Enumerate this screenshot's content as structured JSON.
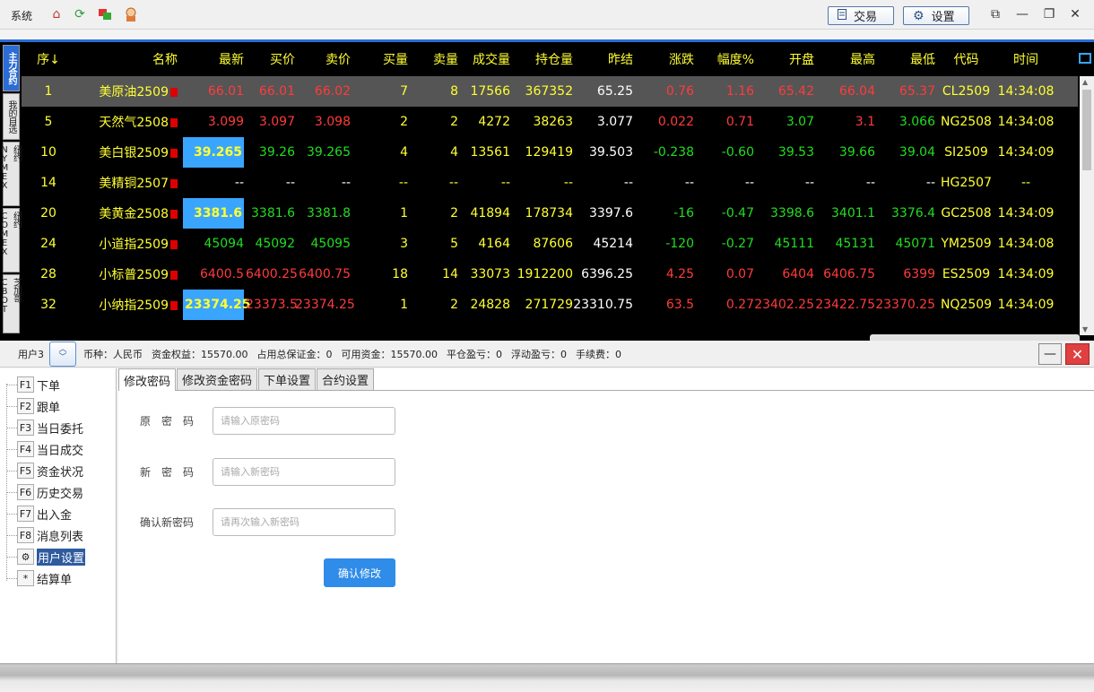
{
  "topbar": {
    "system_menu": "系统",
    "trade_button": "交易",
    "settings_button": "设置"
  },
  "vtabs": [
    "主力合约",
    "我的自选",
    "纽约NYMEX",
    "纽约COMEX",
    "芝加哥CBOT"
  ],
  "quote_headers": {
    "seq": "序↓",
    "name": "名称",
    "last": "最新",
    "bid": "买价",
    "ask": "卖价",
    "bid_qty": "买量",
    "ask_qty": "卖量",
    "volume": "成交量",
    "oi": "持仓量",
    "pre": "昨结",
    "chg": "涨跌",
    "pct": "幅度%",
    "open": "开盘",
    "high": "最高",
    "low": "最低",
    "code": "代码",
    "time": "时间"
  },
  "quotes": [
    {
      "seq": "1",
      "name": "美原油2509",
      "last": "66.01",
      "bid": "66.01",
      "ask": "66.02",
      "bid_qty": "7",
      "ask_qty": "8",
      "volume": "17566",
      "oi": "367352",
      "pre": "65.25",
      "chg": "0.76",
      "pct": "1.16",
      "open": "65.42",
      "high": "66.04",
      "low": "65.37",
      "code": "CL2509",
      "time": "14:34:08",
      "dir": "up",
      "selected": true,
      "hl": false
    },
    {
      "seq": "5",
      "name": "天然气2508",
      "last": "3.099",
      "bid": "3.097",
      "ask": "3.098",
      "bid_qty": "2",
      "ask_qty": "2",
      "volume": "4272",
      "oi": "38263",
      "pre": "3.077",
      "chg": "0.022",
      "pct": "0.71",
      "open": "3.07",
      "high": "3.1",
      "low": "3.066",
      "code": "NG2508",
      "time": "14:34:08",
      "dir": "up",
      "open_dir": "down",
      "high_dir": "up",
      "low_dir": "down"
    },
    {
      "seq": "10",
      "name": "美白银2509",
      "last": "39.265",
      "bid": "39.26",
      "ask": "39.265",
      "bid_qty": "4",
      "ask_qty": "4",
      "volume": "13561",
      "oi": "129419",
      "pre": "39.503",
      "chg": "-0.238",
      "pct": "-0.60",
      "open": "39.53",
      "high": "39.66",
      "low": "39.04",
      "code": "SI2509",
      "time": "14:34:09",
      "dir": "down",
      "hl": true
    },
    {
      "seq": "14",
      "name": "美精铜2507",
      "last": "--",
      "bid": "--",
      "ask": "--",
      "bid_qty": "--",
      "ask_qty": "--",
      "volume": "--",
      "oi": "--",
      "pre": "--",
      "chg": "--",
      "pct": "--",
      "open": "--",
      "high": "--",
      "low": "--",
      "code": "HG2507",
      "time": "--",
      "dir": "none"
    },
    {
      "seq": "20",
      "name": "美黄金2508",
      "last": "3381.6",
      "bid": "3381.6",
      "ask": "3381.8",
      "bid_qty": "1",
      "ask_qty": "2",
      "volume": "41894",
      "oi": "178734",
      "pre": "3397.6",
      "chg": "-16",
      "pct": "-0.47",
      "open": "3398.6",
      "high": "3401.1",
      "low": "3376.4",
      "code": "GC2508",
      "time": "14:34:09",
      "dir": "down",
      "hl": true
    },
    {
      "seq": "24",
      "name": "小道指2509",
      "last": "45094",
      "bid": "45092",
      "ask": "45095",
      "bid_qty": "3",
      "ask_qty": "5",
      "volume": "4164",
      "oi": "87606",
      "pre": "45214",
      "chg": "-120",
      "pct": "-0.27",
      "open": "45111",
      "high": "45131",
      "low": "45071",
      "code": "YM2509",
      "time": "14:34:08",
      "dir": "down"
    },
    {
      "seq": "28",
      "name": "小标普2509",
      "last": "6400.5",
      "bid": "6400.25",
      "ask": "6400.75",
      "bid_qty": "18",
      "ask_qty": "14",
      "volume": "33073",
      "oi": "1912200",
      "pre": "6396.25",
      "chg": "4.25",
      "pct": "0.07",
      "open": "6404",
      "high": "6406.75",
      "low": "6399",
      "code": "ES2509",
      "time": "14:34:09",
      "dir": "up"
    },
    {
      "seq": "32",
      "name": "小纳指2509",
      "last": "23374.25",
      "bid": "23373.5",
      "ask": "23374.25",
      "bid_qty": "1",
      "ask_qty": "2",
      "volume": "24828",
      "oi": "271729",
      "pre": "23310.75",
      "chg": "63.5",
      "pct": "0.27",
      "open": "23402.25",
      "high": "23422.75",
      "low": "23370.25",
      "code": "NQ2509",
      "time": "14:34:09",
      "dir": "up",
      "hl": true
    }
  ],
  "account": {
    "user": "用户3",
    "currency": "币种：人民币",
    "equity": "资金权益：15570.00",
    "margin": "占用总保证金：0",
    "available": "可用资金：15570.00",
    "close_pl": "平仓盈亏：0",
    "float_pl": "浮动盈亏：0",
    "fee": "手续费：0"
  },
  "tree": [
    {
      "key": "F1",
      "label": "下单"
    },
    {
      "key": "F2",
      "label": "跟单"
    },
    {
      "key": "F3",
      "label": "当日委托"
    },
    {
      "key": "F4",
      "label": "当日成交"
    },
    {
      "key": "F5",
      "label": "资金状况"
    },
    {
      "key": "F6",
      "label": "历史交易"
    },
    {
      "key": "F7",
      "label": "出入金"
    },
    {
      "key": "F8",
      "label": "消息列表"
    },
    {
      "key": "⚙",
      "label": "用户设置",
      "selected": true
    },
    {
      "key": "*",
      "label": "结算单"
    }
  ],
  "settings_tabs": [
    "修改密码",
    "修改资金密码",
    "下单设置",
    "合约设置"
  ],
  "form": {
    "old_label": "原　密　码",
    "old_placeholder": "请输入原密码",
    "new_label": "新　密　码",
    "new_placeholder": "请输入新密码",
    "confirm_label": "确认新密码",
    "confirm_placeholder": "请再次输入新密码",
    "submit": "确认修改"
  },
  "colors": {
    "up": "#ff3b3b",
    "down": "#22dd22",
    "accent": "#2b6cd6",
    "header": "#ffff33",
    "highlight": "#3aa5ff"
  }
}
